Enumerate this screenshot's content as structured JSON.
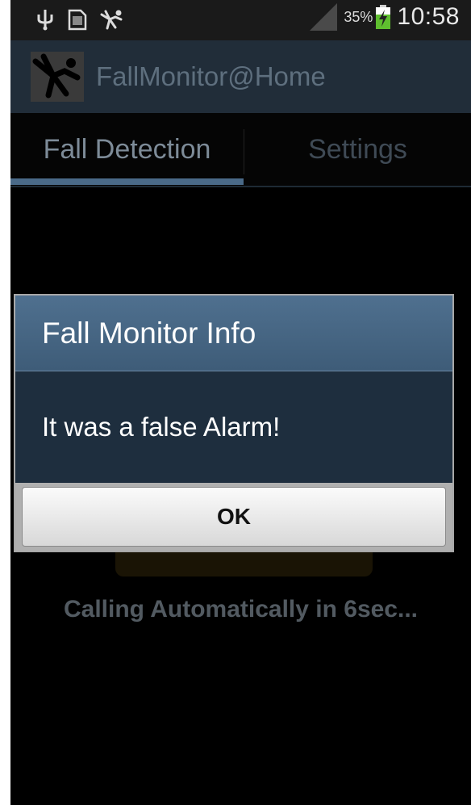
{
  "status_bar": {
    "battery_percent": "35%",
    "time": "10:58",
    "icons": [
      "usb-icon",
      "sd-card-icon",
      "falling-person-icon",
      "signal-icon",
      "battery-charging-icon"
    ]
  },
  "action_bar": {
    "title": "FallMonitor@Home",
    "app_icon": "falling-person-icon"
  },
  "tabs": [
    {
      "label": "Fall Detection",
      "selected": true
    },
    {
      "label": "Settings",
      "selected": false
    }
  ],
  "main": {
    "status_text": "Calling Automatically in 6sec..."
  },
  "dialog": {
    "title": "Fall Monitor Info",
    "message": "It was a false Alarm!",
    "ok_label": "OK"
  },
  "colors": {
    "accent": "#4a6a88",
    "dialog_header": "#46657f",
    "dialog_body": "#1e2e3e"
  }
}
